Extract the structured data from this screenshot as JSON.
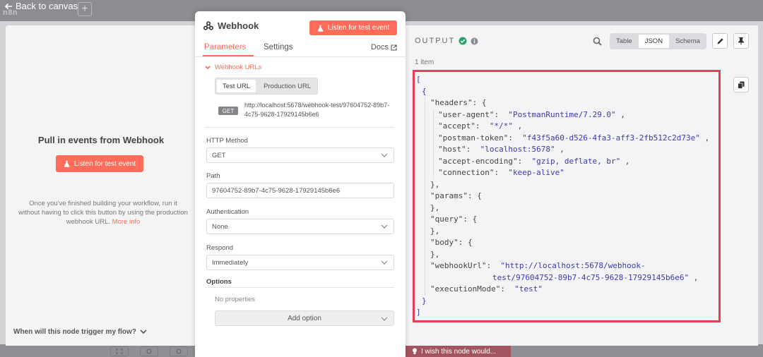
{
  "topbar": {
    "back_label": "Back to canvas",
    "logo_text": "n8n",
    "add_label": "+"
  },
  "input_panel": {
    "title": "Pull in events from Webhook",
    "listen_button": "Listen for test event",
    "description": "Once you've finished building your workflow, run it without having to click this button by using the production webhook URL.",
    "more_info": "More info",
    "footer_question": "When will this node trigger my flow?"
  },
  "node": {
    "title": "Webhook",
    "listen_button": "Listen for test event",
    "tabs": [
      "Parameters",
      "Settings"
    ],
    "docs_label": "Docs",
    "webhook_urls_label": "Webhook URLs",
    "url_tabs": [
      "Test URL",
      "Production URL"
    ],
    "method_badge": "GET",
    "url": "http://localhost:5678/webhook-test/97604752-89b7-4c75-9628-17929145b6e6",
    "fields": [
      {
        "label": "HTTP Method",
        "value": "GET"
      },
      {
        "label": "Path",
        "value": "97604752-89b7-4c75-9628-17929145b6e6"
      },
      {
        "label": "Authentication",
        "value": "None"
      },
      {
        "label": "Respond",
        "value": "Immediately"
      }
    ],
    "options_label": "Options",
    "no_properties": "No properties",
    "add_option": "Add option"
  },
  "output": {
    "title": "OUTPUT",
    "item_count": "1 item",
    "view_modes": [
      "Table",
      "JSON",
      "Schema"
    ],
    "active_view": "JSON",
    "json_lines": [
      {
        "indent": 0,
        "text": "[",
        "kind": "bracket"
      },
      {
        "indent": 1,
        "text": "{",
        "kind": "bracket"
      },
      {
        "indent": 2,
        "key": "\"headers\"",
        "after": ": {"
      },
      {
        "indent": 3,
        "key": "\"user-agent\"",
        "value": "\"PostmanRuntime/7.29.0\"",
        "comma": ","
      },
      {
        "indent": 3,
        "key": "\"accept\"",
        "value": "\"*/*\"",
        "comma": ","
      },
      {
        "indent": 3,
        "key": "\"postman-token\"",
        "value": "\"f43f5a60-d526-4fa3-aff3-2fb512c2d73e\"",
        "comma": ","
      },
      {
        "indent": 3,
        "key": "\"host\"",
        "value": "\"localhost:5678\"",
        "comma": ","
      },
      {
        "indent": 3,
        "key": "\"accept-encoding\"",
        "value": "\"gzip, deflate, br\"",
        "comma": ","
      },
      {
        "indent": 3,
        "key": "\"connection\"",
        "value": "\"keep-alive\""
      },
      {
        "indent": 2,
        "text": "},",
        "kind": "punc"
      },
      {
        "indent": 2,
        "key": "\"params\"",
        "after": ": {"
      },
      {
        "indent": 2,
        "text": "},",
        "kind": "punc"
      },
      {
        "indent": 2,
        "key": "\"query\"",
        "after": ": {"
      },
      {
        "indent": 2,
        "text": "},",
        "kind": "punc"
      },
      {
        "indent": 2,
        "key": "\"body\"",
        "after": ": {"
      },
      {
        "indent": 2,
        "text": "},",
        "kind": "punc"
      },
      {
        "indent": 2,
        "key": "\"webhookUrl\"",
        "value": "\"http://localhost:5678/webhook-"
      },
      {
        "indent": 2,
        "continuation": "test/97604752-89b7-4c75-9628-17929145b6e6\"",
        "comma": ","
      },
      {
        "indent": 2,
        "key": "\"executionMode\"",
        "value": "\"test\""
      },
      {
        "indent": 1,
        "text": "}",
        "kind": "bracket"
      },
      {
        "indent": 0,
        "text": "]",
        "kind": "bracket"
      }
    ]
  },
  "bottom": {
    "wish_text": "I wish this node would..."
  },
  "colors": {
    "accent": "#ff6d5a",
    "highlight_border": "#e73d55",
    "success": "#29a36a"
  }
}
